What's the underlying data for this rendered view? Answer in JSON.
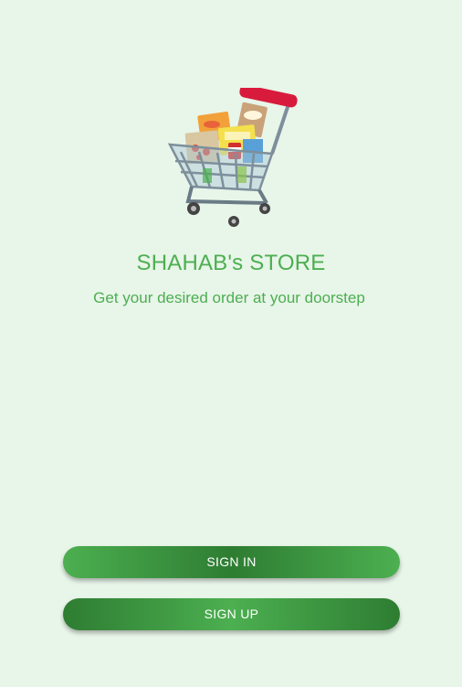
{
  "app": {
    "logo_icon": "shopping-cart-icon",
    "title": "SHAHAB's STORE",
    "subtitle": "Get your desired order at your doorstep"
  },
  "actions": {
    "sign_in_label": "SIGN IN",
    "sign_up_label": "SIGN UP"
  },
  "colors": {
    "background": "#e8f5e9",
    "accent": "#4caf50",
    "accent_dark": "#2e7d32"
  }
}
